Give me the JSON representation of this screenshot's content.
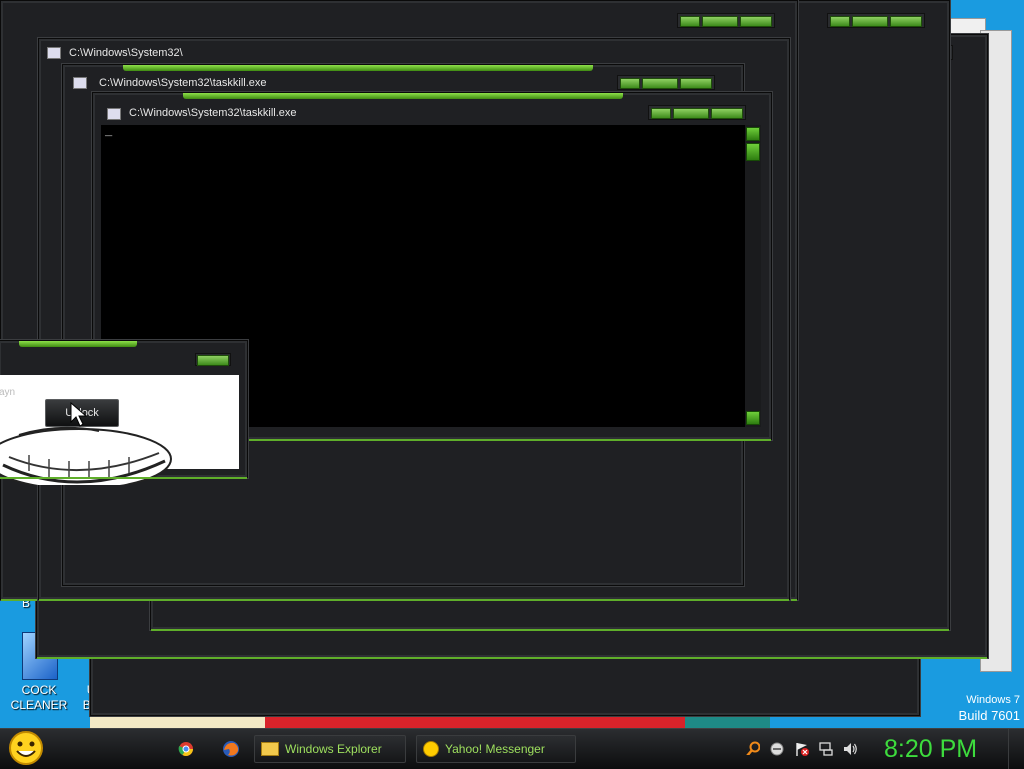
{
  "windows": {
    "back_title": "C:\\Windows\\System32\\",
    "mid_title": "C:\\Windows\\System32\\taskkill.exe",
    "front_title": "C:\\Windows\\System32\\taskkill.exe",
    "console_cursor": "_"
  },
  "popup": {
    "partial_text": "ayn",
    "unlock_button": "Unlock"
  },
  "desktop": {
    "icon_partial_letter": "B",
    "icon1_label_line1": "COCK",
    "icon1_label_line2": "CLEANER",
    "icon2_label_line1": "ULTR",
    "icon2_label_line2": "BLOAT",
    "watermark_line1": "Windows 7",
    "watermark_line2": "Build 7601"
  },
  "taskbar": {
    "buttons": [
      {
        "label": "Windows Explorer",
        "icon": "folder-icon"
      },
      {
        "label": "Yahoo! Messenger",
        "icon": "yahoo-messenger-icon"
      }
    ],
    "quick_launch": [
      "chrome-icon",
      "firefox-icon"
    ],
    "clock": "8:20 PM"
  },
  "colors": {
    "accent_green": "#5fae2a",
    "clock_green": "#3ddc3d",
    "desktop_blue": "#1a9be0",
    "window_bg": "#1f2023"
  }
}
